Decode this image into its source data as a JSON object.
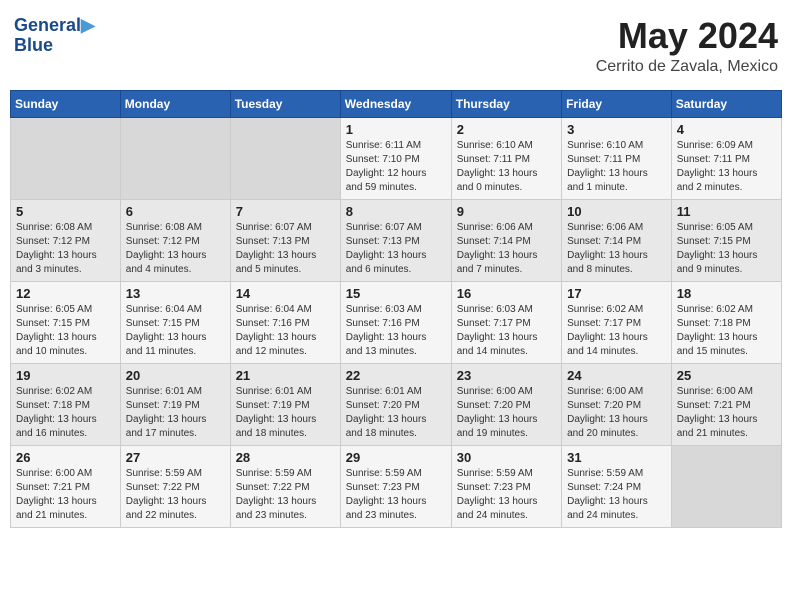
{
  "header": {
    "logo_line1": "General",
    "logo_line2": "Blue",
    "main_title": "May 2024",
    "subtitle": "Cerrito de Zavala, Mexico"
  },
  "calendar": {
    "days_of_week": [
      "Sunday",
      "Monday",
      "Tuesday",
      "Wednesday",
      "Thursday",
      "Friday",
      "Saturday"
    ],
    "weeks": [
      [
        {
          "day": "",
          "info": ""
        },
        {
          "day": "",
          "info": ""
        },
        {
          "day": "",
          "info": ""
        },
        {
          "day": "1",
          "info": "Sunrise: 6:11 AM\nSunset: 7:10 PM\nDaylight: 12 hours\nand 59 minutes."
        },
        {
          "day": "2",
          "info": "Sunrise: 6:10 AM\nSunset: 7:11 PM\nDaylight: 13 hours\nand 0 minutes."
        },
        {
          "day": "3",
          "info": "Sunrise: 6:10 AM\nSunset: 7:11 PM\nDaylight: 13 hours\nand 1 minute."
        },
        {
          "day": "4",
          "info": "Sunrise: 6:09 AM\nSunset: 7:11 PM\nDaylight: 13 hours\nand 2 minutes."
        }
      ],
      [
        {
          "day": "5",
          "info": "Sunrise: 6:08 AM\nSunset: 7:12 PM\nDaylight: 13 hours\nand 3 minutes."
        },
        {
          "day": "6",
          "info": "Sunrise: 6:08 AM\nSunset: 7:12 PM\nDaylight: 13 hours\nand 4 minutes."
        },
        {
          "day": "7",
          "info": "Sunrise: 6:07 AM\nSunset: 7:13 PM\nDaylight: 13 hours\nand 5 minutes."
        },
        {
          "day": "8",
          "info": "Sunrise: 6:07 AM\nSunset: 7:13 PM\nDaylight: 13 hours\nand 6 minutes."
        },
        {
          "day": "9",
          "info": "Sunrise: 6:06 AM\nSunset: 7:14 PM\nDaylight: 13 hours\nand 7 minutes."
        },
        {
          "day": "10",
          "info": "Sunrise: 6:06 AM\nSunset: 7:14 PM\nDaylight: 13 hours\nand 8 minutes."
        },
        {
          "day": "11",
          "info": "Sunrise: 6:05 AM\nSunset: 7:15 PM\nDaylight: 13 hours\nand 9 minutes."
        }
      ],
      [
        {
          "day": "12",
          "info": "Sunrise: 6:05 AM\nSunset: 7:15 PM\nDaylight: 13 hours\nand 10 minutes."
        },
        {
          "day": "13",
          "info": "Sunrise: 6:04 AM\nSunset: 7:15 PM\nDaylight: 13 hours\nand 11 minutes."
        },
        {
          "day": "14",
          "info": "Sunrise: 6:04 AM\nSunset: 7:16 PM\nDaylight: 13 hours\nand 12 minutes."
        },
        {
          "day": "15",
          "info": "Sunrise: 6:03 AM\nSunset: 7:16 PM\nDaylight: 13 hours\nand 13 minutes."
        },
        {
          "day": "16",
          "info": "Sunrise: 6:03 AM\nSunset: 7:17 PM\nDaylight: 13 hours\nand 14 minutes."
        },
        {
          "day": "17",
          "info": "Sunrise: 6:02 AM\nSunset: 7:17 PM\nDaylight: 13 hours\nand 14 minutes."
        },
        {
          "day": "18",
          "info": "Sunrise: 6:02 AM\nSunset: 7:18 PM\nDaylight: 13 hours\nand 15 minutes."
        }
      ],
      [
        {
          "day": "19",
          "info": "Sunrise: 6:02 AM\nSunset: 7:18 PM\nDaylight: 13 hours\nand 16 minutes."
        },
        {
          "day": "20",
          "info": "Sunrise: 6:01 AM\nSunset: 7:19 PM\nDaylight: 13 hours\nand 17 minutes."
        },
        {
          "day": "21",
          "info": "Sunrise: 6:01 AM\nSunset: 7:19 PM\nDaylight: 13 hours\nand 18 minutes."
        },
        {
          "day": "22",
          "info": "Sunrise: 6:01 AM\nSunset: 7:20 PM\nDaylight: 13 hours\nand 18 minutes."
        },
        {
          "day": "23",
          "info": "Sunrise: 6:00 AM\nSunset: 7:20 PM\nDaylight: 13 hours\nand 19 minutes."
        },
        {
          "day": "24",
          "info": "Sunrise: 6:00 AM\nSunset: 7:20 PM\nDaylight: 13 hours\nand 20 minutes."
        },
        {
          "day": "25",
          "info": "Sunrise: 6:00 AM\nSunset: 7:21 PM\nDaylight: 13 hours\nand 21 minutes."
        }
      ],
      [
        {
          "day": "26",
          "info": "Sunrise: 6:00 AM\nSunset: 7:21 PM\nDaylight: 13 hours\nand 21 minutes."
        },
        {
          "day": "27",
          "info": "Sunrise: 5:59 AM\nSunset: 7:22 PM\nDaylight: 13 hours\nand 22 minutes."
        },
        {
          "day": "28",
          "info": "Sunrise: 5:59 AM\nSunset: 7:22 PM\nDaylight: 13 hours\nand 23 minutes."
        },
        {
          "day": "29",
          "info": "Sunrise: 5:59 AM\nSunset: 7:23 PM\nDaylight: 13 hours\nand 23 minutes."
        },
        {
          "day": "30",
          "info": "Sunrise: 5:59 AM\nSunset: 7:23 PM\nDaylight: 13 hours\nand 24 minutes."
        },
        {
          "day": "31",
          "info": "Sunrise: 5:59 AM\nSunset: 7:24 PM\nDaylight: 13 hours\nand 24 minutes."
        },
        {
          "day": "",
          "info": ""
        }
      ]
    ]
  }
}
